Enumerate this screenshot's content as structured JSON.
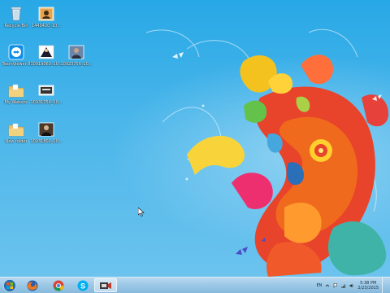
{
  "desktop_icons": [
    {
      "label": "Recycle Bin",
      "icon": "recycle-bin-icon"
    },
    {
      "label": "1440420_10...",
      "icon": "photo-icon"
    },
    {
      "label": "TeamViewer 8",
      "icon": "teamviewer-icon"
    },
    {
      "label": "10919060_10...",
      "icon": "photo-icon"
    },
    {
      "label": "10923756_10...",
      "icon": "photo-icon"
    },
    {
      "label": "My Website",
      "icon": "folder-icon"
    },
    {
      "label": "10931756_10...",
      "icon": "photo-icon"
    },
    {
      "label": "New folder",
      "icon": "folder-icon"
    },
    {
      "label": "10931802_10...",
      "icon": "photo-icon"
    }
  ],
  "taskbar": {
    "start_icon": "windows-start-icon",
    "pinned": [
      {
        "name": "firefox-icon"
      },
      {
        "name": "chrome-icon"
      },
      {
        "name": "skype-icon"
      },
      {
        "name": "camtasia-icon"
      }
    ],
    "tray": {
      "language": "EN",
      "time": "5:38 PM",
      "date": "2/23/2015"
    }
  },
  "colors": {
    "desktop_top": "#28a8e6",
    "desktop_bottom": "#6cc3ee",
    "taskbar": "#9cc8e6"
  }
}
